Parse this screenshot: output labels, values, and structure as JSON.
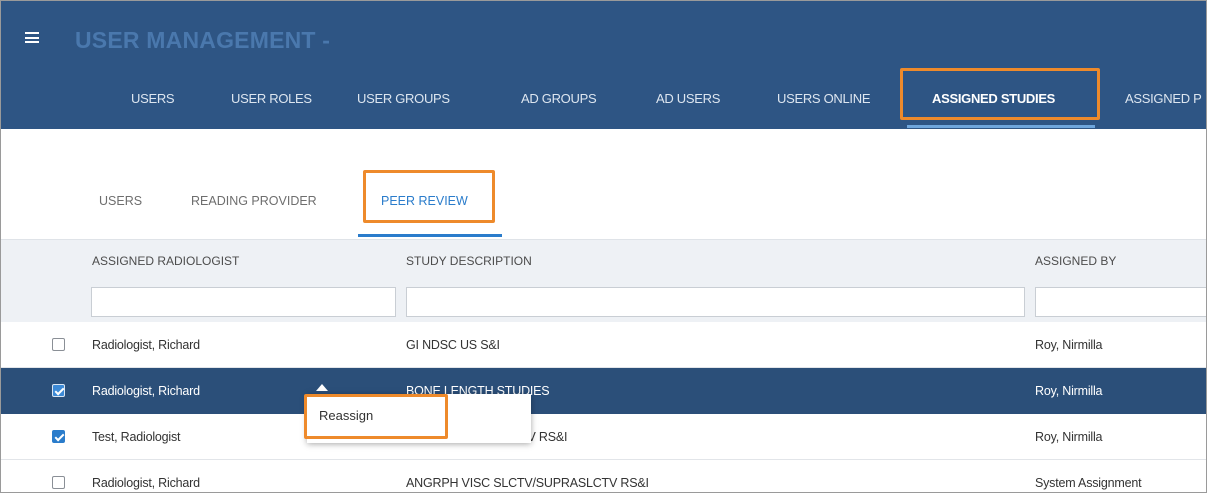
{
  "header": {
    "title": "USER MANAGEMENT -",
    "tabs": [
      {
        "label": "USERS"
      },
      {
        "label": "USER ROLES"
      },
      {
        "label": "USER GROUPS"
      },
      {
        "label": "AD GROUPS"
      },
      {
        "label": "AD USERS"
      },
      {
        "label": "USERS ONLINE"
      },
      {
        "label": "ASSIGNED STUDIES",
        "active": true
      },
      {
        "label": "ASSIGNED P"
      }
    ]
  },
  "subtabs": [
    {
      "label": "USERS"
    },
    {
      "label": "READING PROVIDER"
    },
    {
      "label": "PEER REVIEW",
      "active": true
    }
  ],
  "grid": {
    "columns": [
      "ASSIGNED RADIOLOGIST",
      "STUDY DESCRIPTION",
      "ASSIGNED BY"
    ],
    "filters": [
      "",
      "",
      ""
    ],
    "rows": [
      {
        "checked": false,
        "selected": false,
        "radiologist": "Radiologist, Richard",
        "study": "GI NDSC US S&I",
        "assigned_by": "Roy, Nirmilla"
      },
      {
        "checked": true,
        "selected": true,
        "radiologist": "Radiologist, Richard",
        "study": "BONE LENGTH STUDIES",
        "assigned_by": "Roy, Nirmilla"
      },
      {
        "checked": true,
        "selected": false,
        "radiologist": "Test, Radiologist",
        "study": "NI SLCTV RS&I",
        "assigned_by": "Roy, Nirmilla"
      },
      {
        "checked": false,
        "selected": false,
        "radiologist": "Radiologist, Richard",
        "study": "ANGRPH VISC SLCTV/SUPRASLCTV RS&I",
        "assigned_by": "System Assignment"
      }
    ]
  },
  "context_menu": {
    "items": [
      "Reassign"
    ]
  },
  "colors": {
    "header_bg": "#2e5584",
    "title_text": "#4a78ad",
    "selected_row": "#2b4f79",
    "accent_blue": "#2a7ccb",
    "highlight_orange": "#ee8a2b"
  }
}
